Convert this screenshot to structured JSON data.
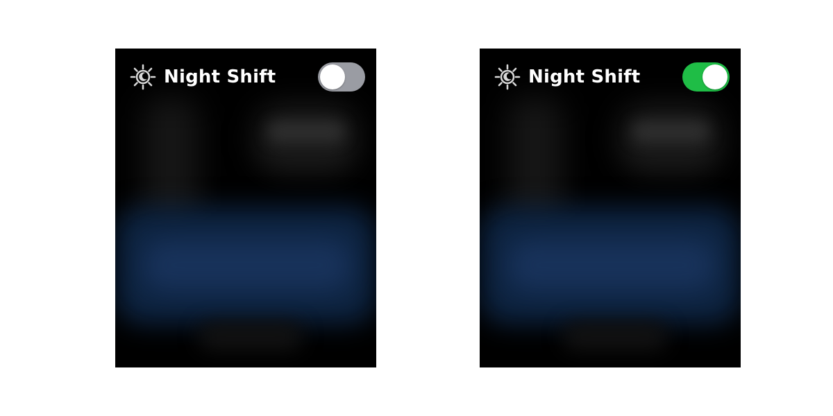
{
  "panels": [
    {
      "title": "Night Shift",
      "toggle": {
        "state": "off",
        "track_color": "#9a9ca3"
      }
    },
    {
      "title": "Night Shift",
      "toggle": {
        "state": "on",
        "track_color": "#1fbd46"
      }
    }
  ],
  "icon": {
    "name": "night-shift-icon",
    "color": "#d8d8d8"
  },
  "colors": {
    "page_background": "#ffffff",
    "panel_background": "#000000",
    "blurred_blue": "#18325a"
  }
}
